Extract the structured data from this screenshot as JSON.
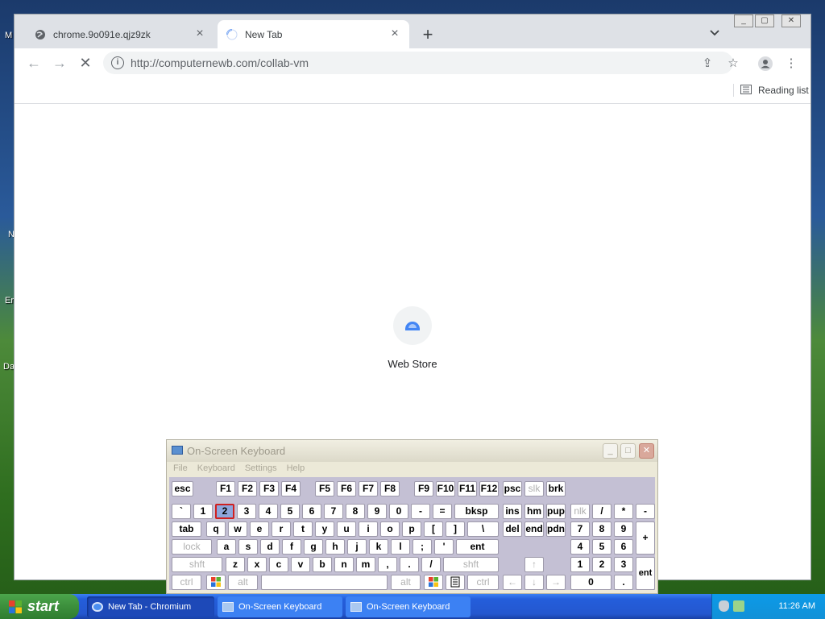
{
  "desktop": {
    "labels": [
      "M",
      "N",
      "Er",
      "Da"
    ]
  },
  "browser": {
    "tabs": [
      {
        "title": "chrome.9o091e.qjz9zk",
        "icon": "globe-icon",
        "active": false
      },
      {
        "title": "New Tab",
        "icon": "loading-spinner-icon",
        "active": true
      }
    ],
    "new_tab_label": "+",
    "address_bar": {
      "url": "http://computernewb.com/collab-vm"
    },
    "bookmarks_bar": {
      "reading_list_label": "Reading list"
    },
    "content": {
      "shortcut_label": "Web Store"
    },
    "window_controls": [
      "minimize",
      "restore",
      "close"
    ]
  },
  "osk": {
    "title": "On-Screen Keyboard",
    "menu": [
      "File",
      "Keyboard",
      "Settings",
      "Help"
    ],
    "pressed_key": "2",
    "rows": {
      "function": [
        "esc",
        "F1",
        "F2",
        "F3",
        "F4",
        "F5",
        "F6",
        "F7",
        "F8",
        "F9",
        "F10",
        "F11",
        "F12",
        "psc",
        "slk",
        "brk"
      ],
      "number": [
        "`",
        "1",
        "2",
        "3",
        "4",
        "5",
        "6",
        "7",
        "8",
        "9",
        "0",
        "-",
        "=",
        "bksp",
        "ins",
        "hm",
        "pup",
        "nlk",
        "/",
        "*",
        "-"
      ],
      "top": [
        "tab",
        "q",
        "w",
        "e",
        "r",
        "t",
        "y",
        "u",
        "i",
        "o",
        "p",
        "[",
        "]",
        "\\",
        "del",
        "end",
        "pdn",
        "7",
        "8",
        "9",
        "+"
      ],
      "home": [
        "lock",
        "a",
        "s",
        "d",
        "f",
        "g",
        "h",
        "j",
        "k",
        "l",
        ";",
        "'",
        "ent",
        "4",
        "5",
        "6"
      ],
      "shift": [
        "shft",
        "z",
        "x",
        "c",
        "v",
        "b",
        "n",
        "m",
        ",",
        ".",
        "/",
        "shft",
        "↑",
        "1",
        "2",
        "3",
        "ent"
      ],
      "bottom": [
        "ctrl",
        "",
        "alt",
        "",
        "alt",
        "",
        "",
        "ctrl",
        "←",
        "↓",
        "→",
        "0",
        "."
      ]
    }
  },
  "taskbar": {
    "start_label": "start",
    "items": [
      {
        "label": "New Tab - Chromium",
        "active": true
      },
      {
        "label": "On-Screen Keyboard",
        "active": false
      },
      {
        "label": "On-Screen Keyboard",
        "active": false
      }
    ],
    "clock": "11:26 AM"
  },
  "colors": {
    "taskbar": "#245edb",
    "start": "#3c8f3c",
    "pressed_key": "#8ea6dc",
    "pressed_border": "#d02020"
  }
}
